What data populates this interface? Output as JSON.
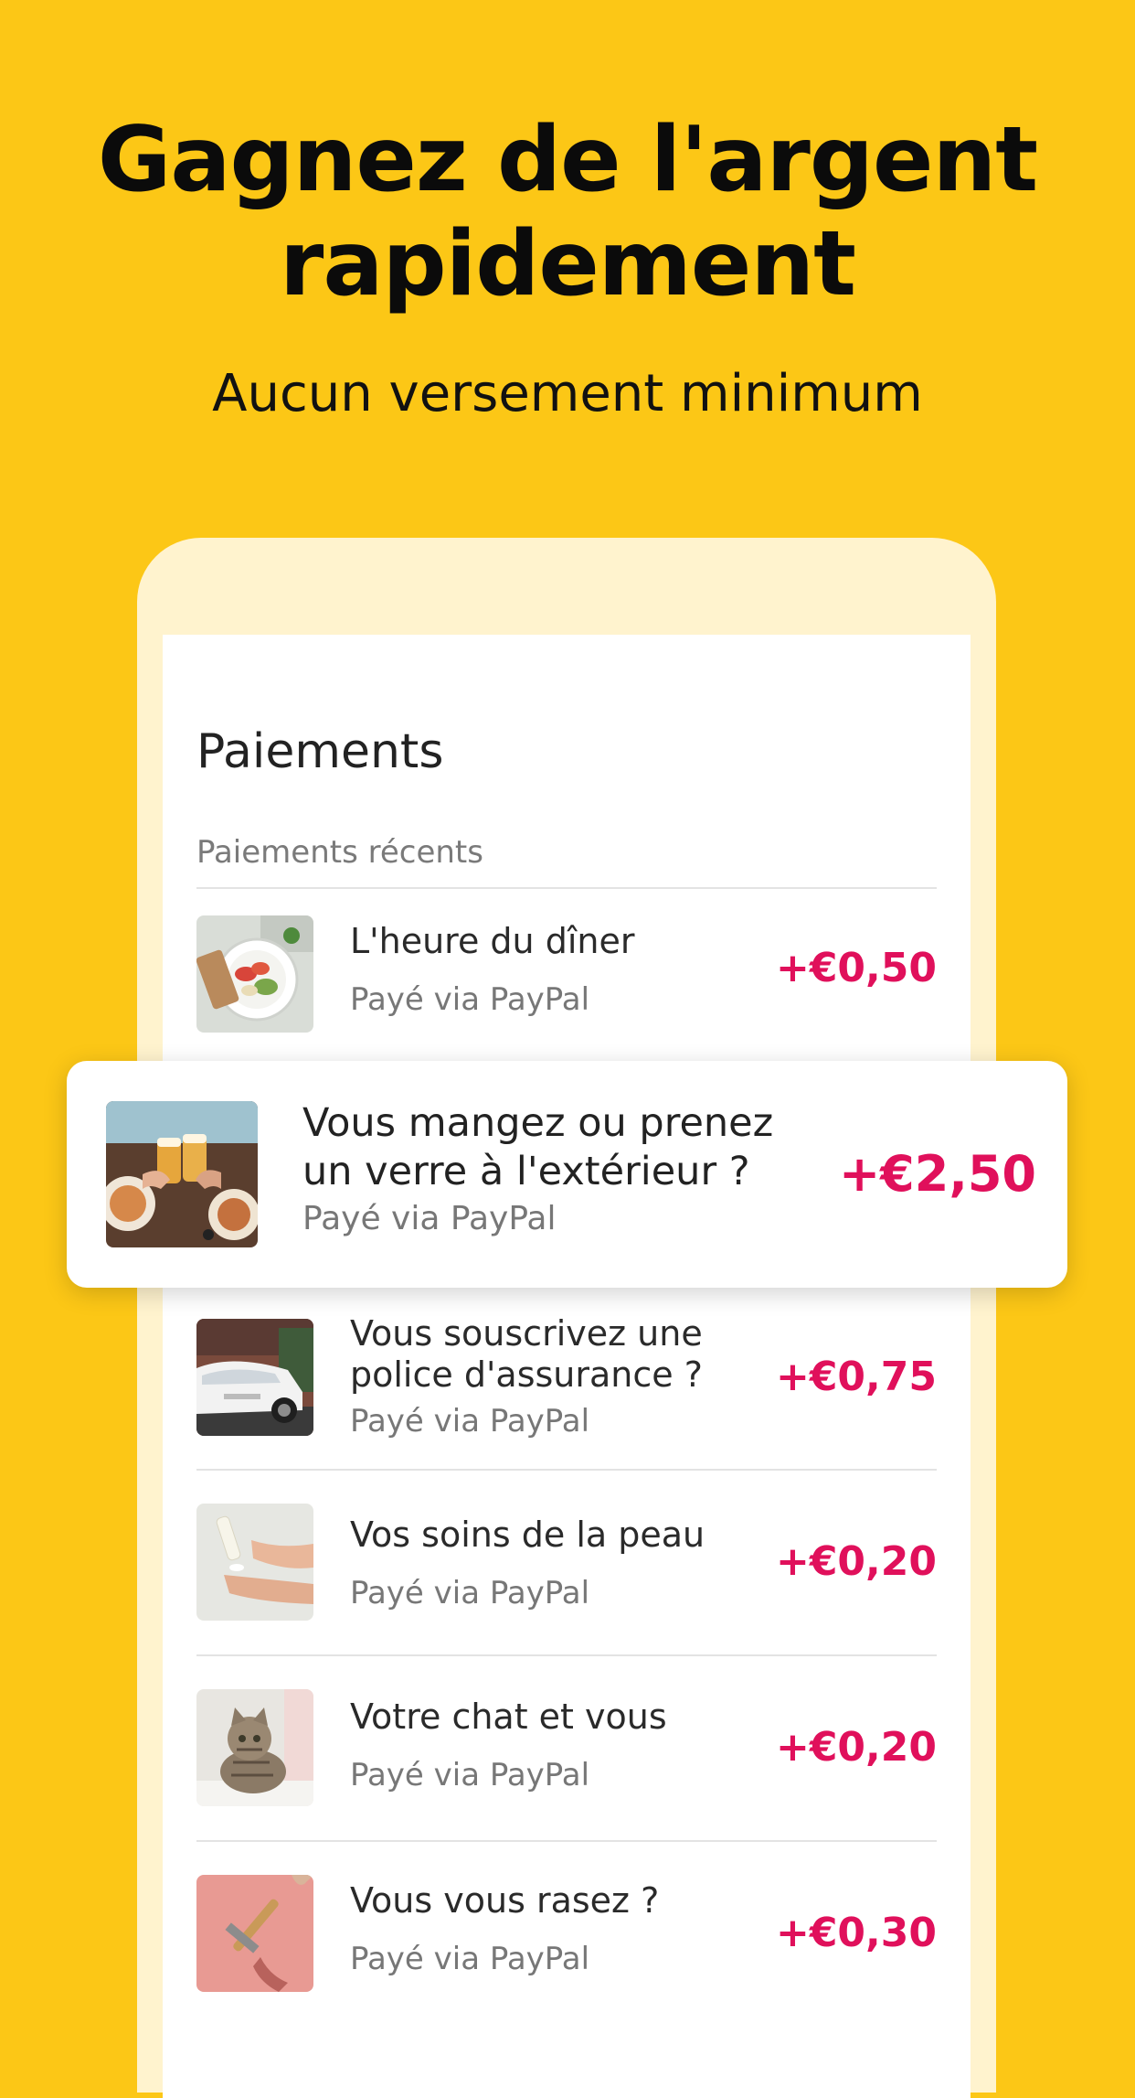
{
  "promo": {
    "headline_line1": "Gagnez de l'argent",
    "headline_line2": "rapidement",
    "subheadline": "Aucun versement minimum"
  },
  "screen": {
    "title": "Paiements",
    "section_label": "Paiements récents"
  },
  "featured": {
    "title_line1": "Vous mangez ou prenez",
    "title_line2": "un verre à l'extérieur ?",
    "subtitle": "Payé via PayPal",
    "amount": "+€2,50",
    "image": "drinks-toast-photo"
  },
  "payments": [
    {
      "title_line1": "L'heure du dîner",
      "title_line2": "",
      "subtitle": "Payé via PayPal",
      "amount": "+€0,50",
      "image": "salad-plate-photo"
    },
    {
      "title_line1": "Vous souscrivez une",
      "title_line2": "police d'assurance ?",
      "subtitle": "Payé via PayPal",
      "amount": "+€0,75",
      "image": "white-car-photo"
    },
    {
      "title_line1": "Vos soins de la peau",
      "title_line2": "",
      "subtitle": "Payé via PayPal",
      "amount": "+€0,20",
      "image": "skincare-tube-photo"
    },
    {
      "title_line1": "Votre chat et vous",
      "title_line2": "",
      "subtitle": "Payé via PayPal",
      "amount": "+€0,20",
      "image": "tabby-cat-photo"
    },
    {
      "title_line1": "Vous vous rasez ?",
      "title_line2": "",
      "subtitle": "Payé via PayPal",
      "amount": "+€0,30",
      "image": "razor-photo"
    }
  ],
  "colors": {
    "background": "#FCC716",
    "phone_frame": "#FFF3CE",
    "amount": "#E0105B"
  }
}
